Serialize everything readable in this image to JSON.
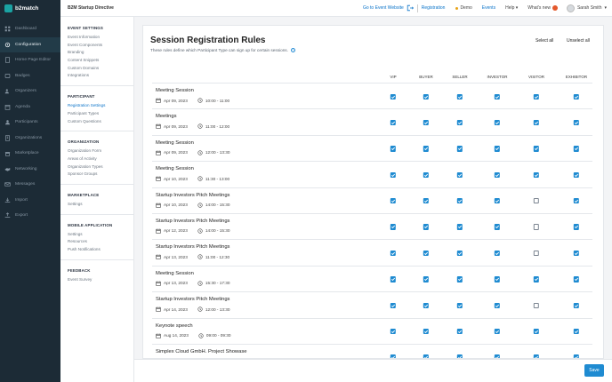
{
  "app": {
    "logo_text": "b2match",
    "event_name": "B2M Startup Directive"
  },
  "topbar": {
    "go_to_event": "Go to Event Website",
    "registration": "Registration",
    "demo": "Demo",
    "events": "Events",
    "help": "Help",
    "whats_new": "What's new",
    "user_name": "Sarah Smith"
  },
  "sidebar": {
    "items": [
      {
        "label": "Dashboard",
        "icon": "dashboard-icon"
      },
      {
        "label": "Configuration",
        "icon": "gear-icon",
        "active": true
      },
      {
        "label": "Home Page Editor",
        "icon": "page-icon"
      },
      {
        "label": "Badges",
        "icon": "badge-icon"
      },
      {
        "label": "Organizers",
        "icon": "users-icon"
      },
      {
        "label": "Agenda",
        "icon": "agenda-icon"
      },
      {
        "label": "Participants",
        "icon": "participants-icon"
      },
      {
        "label": "Organizations",
        "icon": "building-icon"
      },
      {
        "label": "Marketplace",
        "icon": "store-icon"
      },
      {
        "label": "Networking",
        "icon": "handshake-icon"
      },
      {
        "label": "Messages",
        "icon": "mail-icon"
      },
      {
        "label": "Import",
        "icon": "import-icon"
      },
      {
        "label": "Export",
        "icon": "export-icon"
      }
    ]
  },
  "subnav": {
    "event_settings": {
      "head": "EVENT SETTINGS",
      "items": [
        "Event Information",
        "Event Components",
        "Branding",
        "Content Snippets",
        "Custom Domains",
        "Integrations"
      ]
    },
    "participant": {
      "head": "PARTICIPANT",
      "items": [
        "Registration Settings",
        "Participant Types",
        "Custom Questions"
      ]
    },
    "organization": {
      "head": "ORGANIZATION",
      "items": [
        "Organization Form",
        "Areas of Activity",
        "Organization Types",
        "Sponsor Groups"
      ]
    },
    "marketplace": {
      "head": "MARKETPLACE",
      "items": [
        "Settings"
      ]
    },
    "mobile": {
      "head": "MOBILE APPLICATION",
      "items": [
        "Settings",
        "Resources",
        "Push Notifications"
      ]
    },
    "feedback": {
      "head": "FEEDBACK",
      "items": [
        "Event Survey"
      ]
    }
  },
  "main": {
    "title": "Session Registration Rules",
    "subtitle": "These rules define which Participant Type can sign up for certain sessions.",
    "select_all": "Select all",
    "unselect_all": "Unselect all",
    "columns": [
      "VIP",
      "BUYER",
      "SELLER",
      "INVESTOR",
      "VISITOR",
      "EXHIBITOR"
    ],
    "sessions": [
      {
        "name": "Meeting Session",
        "date": "Apr 09, 2023",
        "time": "10:00 - 11:00",
        "checks": [
          true,
          true,
          true,
          true,
          true,
          true
        ]
      },
      {
        "name": "Meetings",
        "date": "Apr 09, 2023",
        "time": "11:00 - 12:00",
        "checks": [
          true,
          true,
          true,
          true,
          true,
          true
        ]
      },
      {
        "name": "Meeting Session",
        "date": "Apr 09, 2023",
        "time": "12:00 - 13:30",
        "checks": [
          true,
          true,
          true,
          true,
          true,
          true
        ]
      },
      {
        "name": "Meeting Session",
        "date": "Apr 10, 2023",
        "time": "11:30 - 13:00",
        "checks": [
          true,
          true,
          true,
          true,
          true,
          true
        ]
      },
      {
        "name": "Startup Investors Pitch Meetings",
        "date": "Apr 10, 2023",
        "time": "14:00 - 15:30",
        "checks": [
          true,
          true,
          true,
          true,
          false,
          true
        ]
      },
      {
        "name": "Startup Investors Pitch Meetings",
        "date": "Apr 12, 2023",
        "time": "14:00 - 15:30",
        "checks": [
          true,
          true,
          true,
          true,
          false,
          true
        ]
      },
      {
        "name": "Startup Investors Pitch Meetings",
        "date": "Apr 13, 2023",
        "time": "11:00 - 12:30",
        "checks": [
          true,
          true,
          true,
          true,
          false,
          true
        ]
      },
      {
        "name": "Meeting Session",
        "date": "Apr 13, 2023",
        "time": "15:30 - 17:30",
        "checks": [
          true,
          true,
          true,
          true,
          true,
          true
        ]
      },
      {
        "name": "Startup Investors Pitch Meetings",
        "date": "Apr 14, 2023",
        "time": "12:00 - 13:30",
        "checks": [
          true,
          true,
          true,
          true,
          false,
          true
        ]
      },
      {
        "name": "Keynote speech",
        "date": "Aug 14, 2023",
        "time": "09:00 - 09:30",
        "checks": [
          true,
          true,
          true,
          true,
          true,
          true
        ]
      },
      {
        "name": "Simplex Cloud GmbH. Project Showase",
        "date": "",
        "time": "",
        "checks": [
          true,
          true,
          true,
          true,
          true,
          true
        ]
      }
    ]
  },
  "footer": {
    "save": "Save"
  },
  "colors": {
    "sidebar_bg": "#1c2b36",
    "accent": "#1f8bd1",
    "link": "#0a73c9"
  }
}
